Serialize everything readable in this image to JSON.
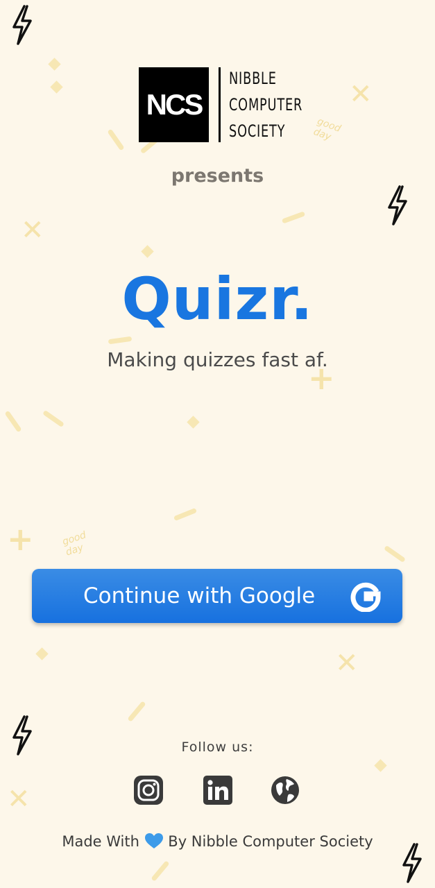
{
  "logo": {
    "mark": "NCS",
    "lines": [
      "NIBBLE",
      "COMPUTER",
      "SOCIETY"
    ]
  },
  "presents": "presents",
  "app": {
    "title": "Quizr.",
    "tagline": "Making quizzes fast af."
  },
  "login": {
    "button_label": "Continue with Google",
    "icon": "google-icon"
  },
  "decor": {
    "goodday": "good day"
  },
  "follow": {
    "label": "Follow us:",
    "icons": [
      "instagram-icon",
      "linkedin-icon",
      "globe-icon"
    ]
  },
  "footer": {
    "prefix": "Made With",
    "suffix": "By Nibble Computer Society"
  },
  "colors": {
    "background": "#fdf7ea",
    "accent": "#1976e0",
    "decor": "#f7e7b4"
  }
}
